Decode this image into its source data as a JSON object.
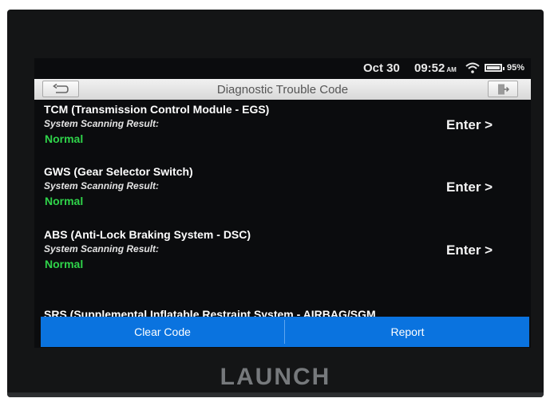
{
  "status_bar": {
    "date": "Oct 30",
    "time": "09:52",
    "ampm": "AM",
    "battery": "95%",
    "icons": [
      "wifi-icon",
      "battery-icon"
    ]
  },
  "title_bar": {
    "title": "Diagnostic Trouble Code",
    "back_icon": "back-arrow-icon",
    "exit_icon": "exit-icon"
  },
  "systems": [
    {
      "name": "TCM (Transmission Control Module - EGS)",
      "label": "System Scanning Result:",
      "status": "Normal",
      "action": "Enter >"
    },
    {
      "name": "GWS (Gear Selector Switch)",
      "label": "System Scanning Result:",
      "status": "Normal",
      "action": "Enter >"
    },
    {
      "name": "ABS (Anti-Lock Braking System - DSC)",
      "label": "System Scanning Result:",
      "status": "Normal",
      "action": "Enter >"
    }
  ],
  "partial_item": "SRS (Supplemental Inflatable Restraint System - AIRBAG/SGM",
  "actions": {
    "clear_code": "Clear Code",
    "report": "Report"
  },
  "brand": "LAUNCH",
  "colors": {
    "accent": "#0a73df",
    "status_normal": "#2fd34a"
  }
}
